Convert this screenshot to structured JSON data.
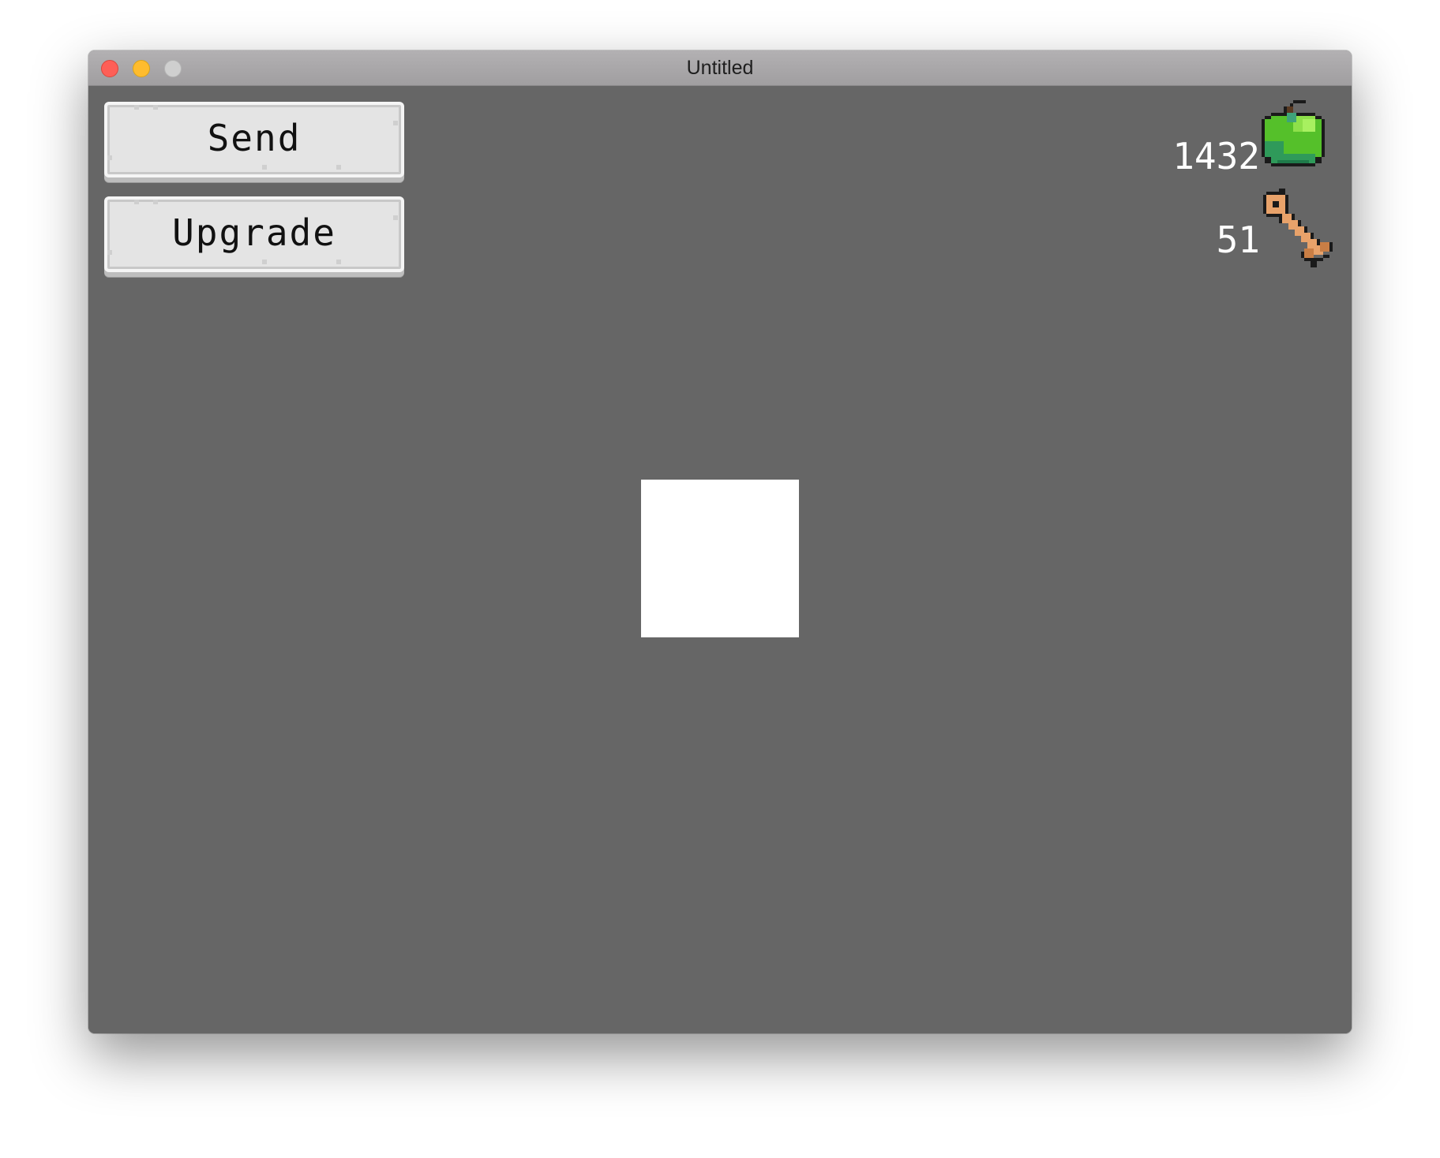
{
  "window": {
    "title": "Untitled"
  },
  "buttons": {
    "send_label": "Send",
    "upgrade_label": "Upgrade"
  },
  "resources": {
    "apples": "1432",
    "keys": "51",
    "apple_icon": "apple-icon",
    "key_icon": "key-icon"
  },
  "colors": {
    "background": "#666666",
    "close": "#fe5f57",
    "minimize": "#febc2e",
    "zoom": "#cfcfcf",
    "button_face": "#e4e4e4",
    "apple_green": "#55c02a",
    "key_orange": "#e8a26a",
    "player": "#ffffff"
  }
}
